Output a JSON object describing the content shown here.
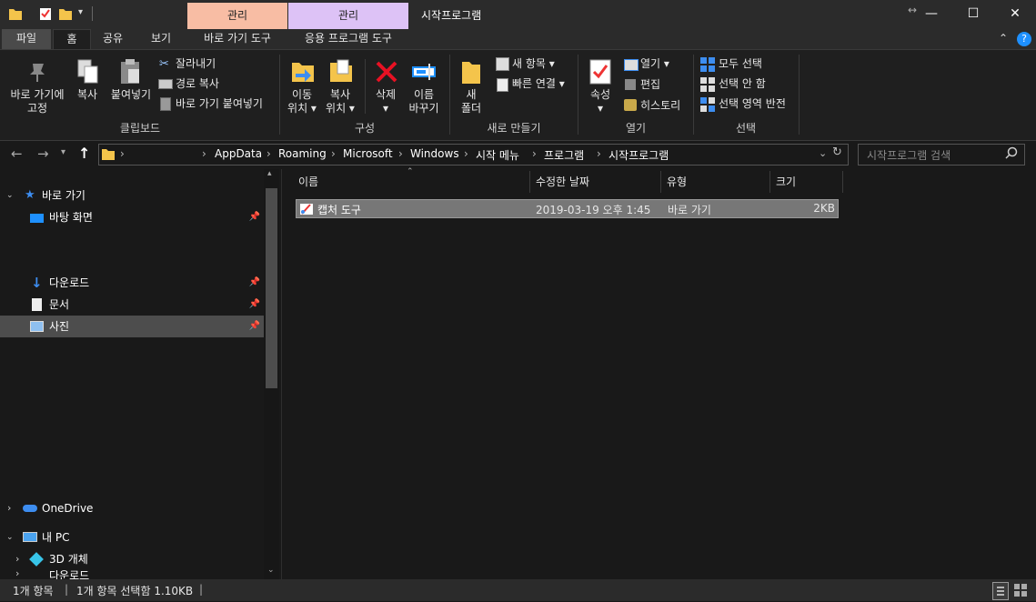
{
  "window": {
    "title": "시작프로그램",
    "context_tabs": [
      {
        "label": "관리",
        "color": "#f8bda4"
      },
      {
        "label": "관리",
        "color": "#ddc2f6"
      }
    ],
    "context_subtabs": [
      "바로 가기 도구",
      "응용 프로그램 도구"
    ]
  },
  "tabs": [
    "파일",
    "홈",
    "공유",
    "보기"
  ],
  "ribbon": {
    "clipboard": {
      "pin": [
        "바로 가기에",
        "고정"
      ],
      "copy": "복사",
      "paste": "붙여넣기",
      "cut": "잘라내기",
      "copy_path": "경로 복사",
      "paste_shortcut": "바로 가기 붙여넣기",
      "group": "클립보드"
    },
    "organize": {
      "move_to": [
        "이동",
        "위치 ▾"
      ],
      "copy_to": [
        "복사",
        "위치 ▾"
      ],
      "delete": [
        "삭제",
        "▾"
      ],
      "rename": [
        "이름",
        "바꾸기"
      ],
      "group": "구성"
    },
    "new": {
      "new_folder": [
        "새",
        "폴더"
      ],
      "new_item": "새 항목 ▾",
      "easy_access": "빠른 연결 ▾",
      "group": "새로 만들기"
    },
    "open": {
      "properties": [
        "속성",
        "▾"
      ],
      "open": "열기 ▾",
      "edit": "편집",
      "history": "히스토리",
      "group": "열기"
    },
    "select": {
      "select_all": "모두 선택",
      "select_none": "선택 안 함",
      "invert": "선택 영역 반전",
      "group": "선택"
    }
  },
  "address": {
    "crumbs": [
      "AppData",
      "Roaming",
      "Microsoft",
      "Windows",
      "시작 메뉴",
      "프로그램",
      "시작프로그램"
    ],
    "search_placeholder": "시작프로그램 검색"
  },
  "nav": {
    "quick_access": "바로 가기",
    "desktop": "바탕 화면",
    "downloads": "다운로드",
    "documents": "문서",
    "pictures": "사진",
    "onedrive": "OneDrive",
    "this_pc": "내 PC",
    "objects3d": "3D 개체",
    "downloads2": "다운로드"
  },
  "columns": [
    "이름",
    "수정한 날짜",
    "유형",
    "크기"
  ],
  "files": [
    {
      "name": "캡처 도구",
      "date": "2019-03-19 오후 1:45",
      "type": "바로 가기",
      "size": "2KB"
    }
  ],
  "status": {
    "count": "1개 항목",
    "selected": "1개 항목 선택함 1.10KB"
  },
  "colors": {
    "background": "#191919",
    "chrome": "#2b2b2b",
    "selection": "#777777",
    "folder_yellow": "#f4c44b",
    "accent_blue": "#1e90ff"
  }
}
